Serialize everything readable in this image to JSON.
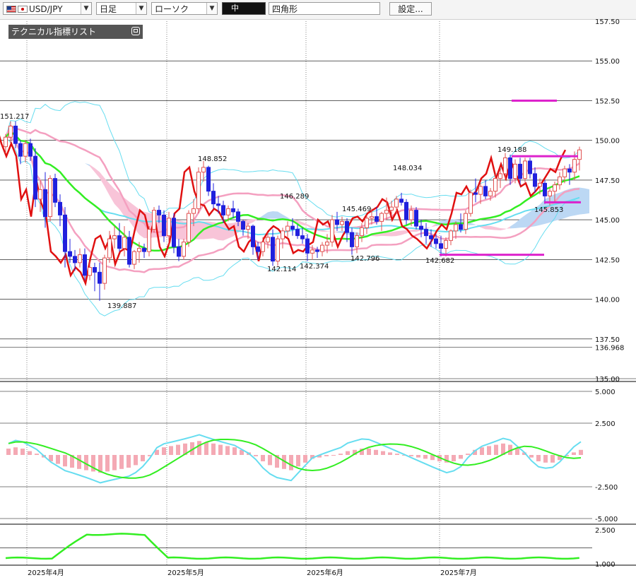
{
  "toolbar": {
    "symbol": "USD/JPY",
    "timeframe": "日足",
    "chart_type": "ローソク",
    "thickness": "中",
    "drawing": "四角形",
    "settings_button": "設定..."
  },
  "panel": {
    "tech_list": "テクニカル指標リスト"
  },
  "chart_data": [
    {
      "type": "candlestick",
      "symbol": "USD/JPY",
      "ylim": [
        135.0,
        157.5
      ],
      "y_ticks": [
        "157.50",
        "155.00",
        "152.50",
        "150.00",
        "147.50",
        "145.00",
        "142.50",
        "140.00",
        "137.50",
        "136.968",
        "135.00"
      ],
      "x_ticks": [
        "2025年4月",
        "2025年5月",
        "2025年6月",
        "2025年7月"
      ],
      "candles": [
        [
          149.6,
          150.4,
          149.2,
          150.2
        ],
        [
          150.2,
          151.2,
          149.8,
          150.9
        ],
        [
          150.9,
          151.2,
          149.5,
          149.8
        ],
        [
          149.8,
          150.0,
          148.5,
          149.0
        ],
        [
          149.0,
          150.0,
          148.6,
          149.8
        ],
        [
          149.8,
          150.1,
          148.7,
          149.0
        ],
        [
          149.0,
          149.5,
          145.8,
          146.3
        ],
        [
          146.3,
          147.5,
          145.5,
          146.9
        ],
        [
          146.9,
          148.0,
          144.5,
          145.2
        ],
        [
          145.2,
          147.8,
          144.9,
          147.6
        ],
        [
          147.6,
          147.9,
          145.8,
          146.1
        ],
        [
          146.1,
          146.6,
          144.6,
          145.3
        ],
        [
          145.3,
          145.8,
          142.0,
          143.0
        ],
        [
          143.0,
          143.8,
          142.3,
          142.7
        ],
        [
          142.7,
          143.1,
          141.8,
          142.3
        ],
        [
          142.3,
          143.2,
          142.0,
          142.8
        ],
        [
          142.8,
          143.2,
          141.2,
          141.5
        ],
        [
          141.5,
          142.4,
          141.2,
          142.0
        ],
        [
          142.0,
          142.3,
          140.5,
          141.7
        ],
        [
          141.7,
          142.3,
          139.9,
          141.0
        ],
        [
          141.0,
          142.8,
          140.6,
          142.6
        ],
        [
          142.6,
          144.3,
          142.3,
          143.8
        ],
        [
          143.8,
          144.6,
          143.2,
          144.0
        ],
        [
          144.0,
          144.8,
          143.0,
          143.2
        ],
        [
          143.2,
          144.6,
          142.7,
          143.9
        ],
        [
          143.9,
          144.3,
          142.0,
          142.2
        ],
        [
          142.2,
          143.1,
          141.9,
          143.0
        ],
        [
          143.0,
          143.6,
          142.3,
          143.2
        ],
        [
          143.2,
          143.5,
          142.6,
          143.0
        ],
        [
          143.0,
          144.6,
          142.7,
          144.4
        ],
        [
          144.4,
          145.8,
          144.2,
          145.6
        ],
        [
          145.6,
          145.9,
          144.8,
          145.3
        ],
        [
          145.3,
          145.6,
          143.6,
          144.0
        ],
        [
          144.0,
          145.5,
          143.4,
          145.1
        ],
        [
          145.1,
          145.4,
          142.9,
          143.3
        ],
        [
          143.3,
          143.8,
          142.4,
          142.7
        ],
        [
          142.7,
          143.8,
          142.5,
          143.6
        ],
        [
          143.6,
          145.6,
          143.3,
          145.4
        ],
        [
          145.4,
          146.3,
          144.6,
          145.7
        ],
        [
          145.7,
          148.3,
          145.4,
          148.0
        ],
        [
          148.0,
          148.7,
          147.4,
          148.3
        ],
        [
          148.3,
          148.4,
          146.5,
          146.8
        ],
        [
          146.8,
          147.3,
          145.7,
          146.0
        ],
        [
          146.0,
          146.5,
          145.4,
          145.9
        ],
        [
          145.9,
          146.2,
          144.8,
          145.3
        ],
        [
          145.3,
          145.9,
          144.9,
          145.7
        ],
        [
          145.7,
          146.2,
          145.1,
          145.5
        ],
        [
          145.5,
          145.7,
          144.6,
          144.9
        ],
        [
          144.9,
          145.0,
          144.0,
          144.4
        ],
        [
          144.4,
          144.8,
          143.8,
          144.6
        ],
        [
          144.6,
          144.7,
          142.8,
          143.3
        ],
        [
          143.3,
          143.6,
          142.5,
          143.0
        ],
        [
          143.0,
          143.9,
          142.7,
          143.6
        ],
        [
          143.6,
          144.2,
          143.2,
          143.9
        ],
        [
          143.9,
          144.4,
          142.1,
          142.4
        ],
        [
          142.4,
          144.0,
          142.1,
          143.8
        ],
        [
          143.8,
          144.5,
          143.2,
          144.3
        ],
        [
          144.3,
          144.9,
          143.9,
          144.6
        ],
        [
          144.6,
          145.1,
          144.0,
          144.4
        ],
        [
          144.4,
          144.7,
          143.8,
          144.0
        ],
        [
          144.0,
          144.5,
          143.5,
          143.8
        ],
        [
          143.8,
          144.1,
          142.4,
          142.9
        ],
        [
          142.9,
          143.4,
          142.5,
          143.1
        ],
        [
          143.1,
          143.3,
          142.6,
          143.0
        ],
        [
          143.0,
          143.6,
          142.7,
          143.4
        ],
        [
          143.4,
          144.1,
          142.9,
          143.6
        ],
        [
          143.6,
          145.3,
          143.3,
          145.0
        ],
        [
          145.0,
          145.5,
          144.3,
          144.7
        ],
        [
          144.7,
          145.2,
          144.3,
          144.9
        ],
        [
          144.9,
          145.1,
          143.6,
          144.2
        ],
        [
          144.2,
          144.5,
          142.8,
          143.3
        ],
        [
          143.3,
          144.2,
          142.9,
          144.0
        ],
        [
          144.0,
          144.8,
          143.6,
          144.5
        ],
        [
          144.5,
          145.3,
          144.1,
          145.1
        ],
        [
          145.1,
          145.7,
          144.7,
          145.2
        ],
        [
          145.2,
          145.8,
          144.7,
          144.9
        ],
        [
          144.9,
          145.5,
          144.3,
          145.4
        ],
        [
          145.4,
          146.4,
          145.0,
          145.6
        ],
        [
          145.6,
          146.2,
          145.2,
          145.8
        ],
        [
          145.8,
          146.5,
          145.4,
          146.3
        ],
        [
          146.3,
          146.7,
          145.9,
          146.1
        ],
        [
          146.1,
          146.3,
          144.7,
          145.0
        ],
        [
          145.0,
          145.9,
          144.6,
          145.6
        ],
        [
          145.6,
          145.8,
          144.4,
          144.6
        ],
        [
          144.6,
          145.0,
          143.9,
          144.4
        ],
        [
          144.4,
          144.8,
          143.5,
          144.0
        ],
        [
          144.0,
          144.4,
          143.3,
          143.8
        ],
        [
          143.8,
          144.1,
          143.2,
          143.5
        ],
        [
          143.5,
          144.0,
          142.7,
          143.2
        ],
        [
          143.2,
          143.9,
          142.7,
          143.7
        ],
        [
          143.7,
          144.4,
          143.4,
          144.3
        ],
        [
          144.3,
          144.9,
          143.8,
          144.7
        ],
        [
          144.7,
          145.4,
          144.2,
          144.4
        ],
        [
          144.4,
          145.6,
          144.1,
          145.4
        ],
        [
          145.4,
          146.9,
          145.2,
          146.7
        ],
        [
          146.7,
          147.6,
          146.1,
          146.6
        ],
        [
          146.6,
          147.3,
          146.0,
          147.1
        ],
        [
          147.1,
          147.5,
          146.3,
          146.5
        ],
        [
          146.5,
          147.0,
          146.2,
          146.8
        ],
        [
          146.8,
          147.9,
          146.4,
          147.6
        ],
        [
          147.6,
          148.3,
          147.0,
          147.9
        ],
        [
          147.9,
          149.2,
          147.5,
          148.9
        ],
        [
          148.9,
          149.1,
          147.2,
          147.6
        ],
        [
          147.6,
          148.8,
          147.3,
          148.5
        ],
        [
          148.5,
          148.9,
          147.2,
          147.6
        ],
        [
          147.6,
          148.9,
          147.3,
          148.7
        ],
        [
          148.7,
          148.9,
          147.6,
          147.9
        ],
        [
          147.9,
          148.3,
          146.7,
          147.1
        ],
        [
          147.1,
          147.6,
          146.6,
          147.3
        ],
        [
          147.3,
          147.5,
          146.0,
          146.5
        ],
        [
          146.5,
          147.0,
          145.9,
          146.8
        ],
        [
          146.8,
          147.4,
          146.1,
          147.2
        ],
        [
          147.2,
          148.0,
          146.9,
          147.7
        ],
        [
          147.7,
          148.4,
          147.3,
          148.2
        ],
        [
          148.2,
          148.5,
          147.2,
          148.0
        ],
        [
          148.0,
          149.3,
          147.5,
          148.8
        ],
        [
          148.8,
          149.6,
          148.1,
          149.4
        ]
      ],
      "annotations": [
        "151.217",
        "148.852",
        "146.289",
        "145.469",
        "148.034",
        "149.188",
        "145.853",
        "142.114",
        "142.374",
        "142.796",
        "142.682",
        "139.887"
      ],
      "series": [
        "ローソク足",
        "移動平均線",
        "ボリンジャーバンド",
        "一目均衡表",
        "遅行スパン"
      ],
      "colors": {
        "up": "#e05050",
        "down": "#2020dd",
        "ma": "#33ee22",
        "bb1": "#f4a0c0",
        "bb2": "#66ddf0",
        "lag": "#e01010",
        "cloud_up": "#f8c4d8",
        "cloud_down": "#bcd8f4",
        "marker": "#dd22cc"
      }
    },
    {
      "type": "macd",
      "ylim": [
        -5.0,
        5.0
      ],
      "y_ticks": [
        "5.000",
        "2.500",
        "-2.500",
        "-5.000"
      ],
      "histogram": [
        0.5,
        0.6,
        0.5,
        0.3,
        0.1,
        -0.2,
        -0.5,
        -0.7,
        -0.9,
        -1.0,
        -1.1,
        -1.2,
        -1.3,
        -1.4,
        -1.3,
        -1.2,
        -1.1,
        -1.0,
        -0.8,
        -0.5,
        -0.1,
        0.4,
        0.6,
        0.7,
        0.8,
        0.9,
        1.0,
        1.1,
        1.0,
        0.9,
        0.8,
        0.7,
        0.6,
        0.4,
        0.2,
        -0.1,
        -0.5,
        -0.8,
        -1.0,
        -1.1,
        -1.2,
        -0.9,
        -0.6,
        -0.3,
        -0.2,
        -0.1,
        0.0,
        0.1,
        0.3,
        0.4,
        0.5,
        0.5,
        0.4,
        0.3,
        0.2,
        0.1,
        0.0,
        -0.1,
        -0.2,
        -0.3,
        -0.4,
        -0.5,
        -0.6,
        -0.5,
        -0.3,
        0.1,
        0.4,
        0.6,
        0.7,
        0.8,
        0.9,
        0.8,
        0.5,
        0.2,
        -0.2,
        -0.5,
        -0.6,
        -0.6,
        -0.4,
        -0.1,
        0.2,
        0.4
      ]
    },
    {
      "type": "line",
      "ylim": [
        1.0,
        2.5
      ],
      "y_ticks": [
        "2.500",
        "1.000"
      ]
    }
  ]
}
